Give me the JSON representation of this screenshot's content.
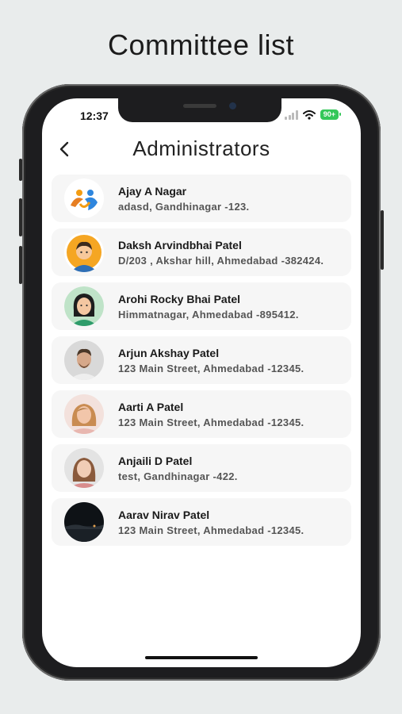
{
  "promo": {
    "title": "Committee list"
  },
  "status_bar": {
    "time": "12:37",
    "battery": "90+"
  },
  "header": {
    "title": "Administrators"
  },
  "members": [
    {
      "name": "Ajay A Nagar",
      "address": "adasd, Gandhinagar -123.",
      "avatar_icon": "logo-figures-icon"
    },
    {
      "name": "Daksh Arvindbhai Patel",
      "address": "D/203 , Akshar hill, Ahmedabad -382424.",
      "avatar_icon": "cartoon-man-icon"
    },
    {
      "name": "Arohi Rocky Bhai Patel",
      "address": "Himmatnagar, Ahmedabad -895412.",
      "avatar_icon": "cartoon-woman-icon"
    },
    {
      "name": "Arjun Akshay Patel",
      "address": "123 Main Street, Ahmedabad -12345.",
      "avatar_icon": "photo-man-icon"
    },
    {
      "name": "Aarti A Patel",
      "address": "123 Main Street, Ahmedabad -12345.",
      "avatar_icon": "photo-woman-icon"
    },
    {
      "name": "Anjaili D Patel",
      "address": "test, Gandhinagar -422.",
      "avatar_icon": "photo-woman-icon"
    },
    {
      "name": "Aarav Nirav Patel",
      "address": "123 Main Street, Ahmedabad -12345.",
      "avatar_icon": "photo-night-sky-icon"
    }
  ],
  "colors": {
    "accent_green": "#34c759",
    "card_bg": "#f6f6f6",
    "page_bg": "#e9ecec"
  }
}
